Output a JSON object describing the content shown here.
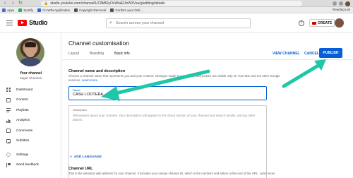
{
  "browser": {
    "url": "studio.youtube.com/channel/UC8kB6yOcWraEUhW3Vsu/g/editing/details",
    "bookmarks": [
      {
        "label": "Apps",
        "color": "#4a6fd1"
      },
      {
        "label": "Spotify",
        "color": "#1db954"
      },
      {
        "label": "Co-WIN Application",
        "color": "#2b6bd8"
      },
      {
        "label": "Copyright Removal",
        "color": "#555555"
      },
      {
        "label": "Confirm your Onli...",
        "color": "#555555"
      }
    ],
    "reading_list": "Reading List"
  },
  "header": {
    "logo_text": "Studio",
    "search_placeholder": "Search across your channel",
    "help_icon": "?",
    "create_label": "CREATE"
  },
  "sidebar": {
    "your_channel": "Your channel",
    "owner_name": "Sagar Chauhan",
    "items": [
      {
        "label": "Dashboard",
        "icon": "dashboard-icon"
      },
      {
        "label": "Content",
        "icon": "content-icon"
      },
      {
        "label": "Playlists",
        "icon": "playlists-icon"
      },
      {
        "label": "Analytics",
        "icon": "analytics-icon"
      },
      {
        "label": "Comments",
        "icon": "comments-icon"
      },
      {
        "label": "Subtitles",
        "icon": "subtitles-icon"
      },
      {
        "label": "Settings",
        "icon": "settings-icon"
      },
      {
        "label": "Send feedback",
        "icon": "feedback-icon"
      }
    ]
  },
  "main": {
    "title": "Channel customisation",
    "tabs": [
      {
        "label": "Layout",
        "active": false
      },
      {
        "label": "Branding",
        "active": false
      },
      {
        "label": "Basic info",
        "active": true
      }
    ],
    "view_channel": "VIEW CHANNEL",
    "cancel": "CANCEL",
    "publish": "PUBLISH",
    "name_section": {
      "heading": "Channel name and description",
      "desc": "Choose a channel name that represents you and your content. Changes made to your name and picture are visible only on YouTube and not other Google services.",
      "learn_more": "Learn more"
    },
    "name_field": {
      "label": "Name",
      "value": "CASH LOOTERA"
    },
    "description_field": {
      "label": "Description",
      "placeholder": "Tell viewers about your channel. Your description will appear in the About section of your channel and search results, among other places."
    },
    "add_language": "ADD LANGUAGE",
    "url_section": {
      "heading": "Channel URL",
      "desc": "This is the standard web address for your channel. It includes your unique channel ID, which is the numbers and letters at the end of the URL. Learn more"
    }
  },
  "colors": {
    "accent": "#065fd4",
    "annotation_arrow": "#1fc7a8",
    "logo_red": "#ff0000"
  }
}
